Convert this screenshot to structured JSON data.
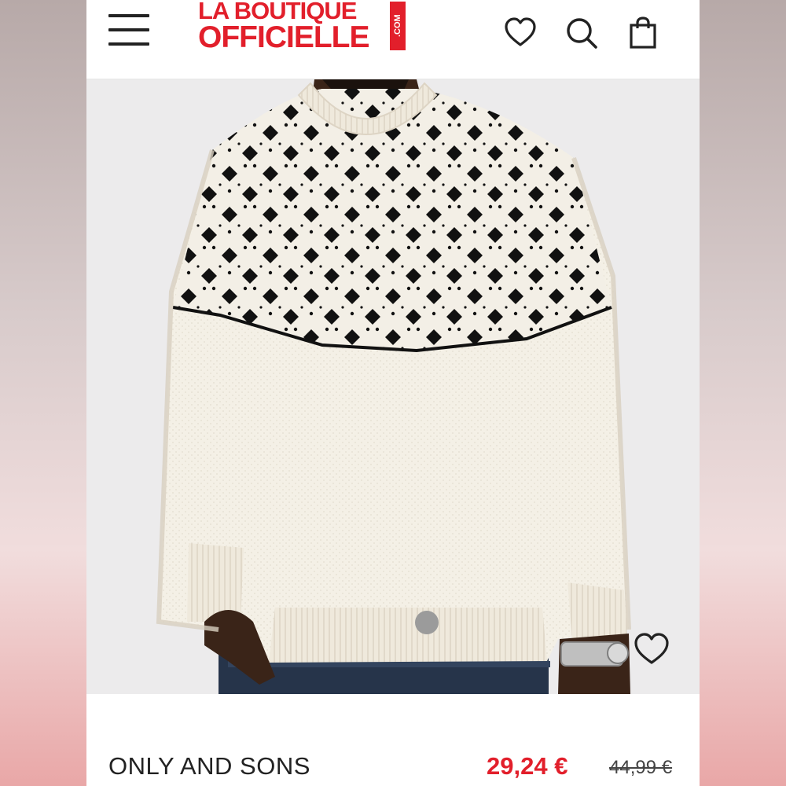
{
  "header": {
    "logo_line1": "LA BOUTIQUE",
    "logo_line2": "OFFICIELLE",
    "logo_suffix": ".COM",
    "brand_color": "#e21f2b",
    "icons": [
      "menu-icon",
      "heart-icon",
      "search-icon",
      "shopping-bag-icon"
    ]
  },
  "gallery": {
    "current_slide": 1,
    "wishlist_icon": "heart-icon"
  },
  "product": {
    "brand": "ONLY AND SONS",
    "price": "29,24 €",
    "old_price": "44,99 €",
    "price_color": "#e21f2b"
  }
}
